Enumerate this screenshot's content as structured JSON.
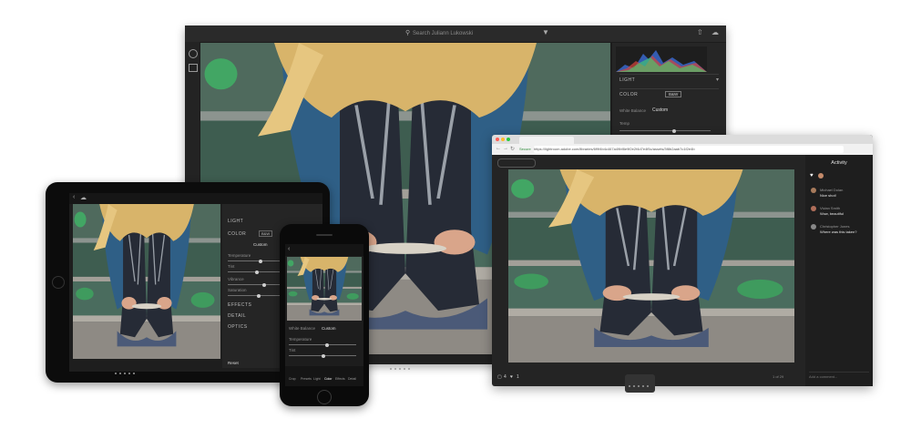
{
  "desktop": {
    "search_placeholder": "Search Juliann Lukowski",
    "panel": {
      "light_label": "LIGHT",
      "color_label": "COLOR",
      "raw_badge": "B&W",
      "white_balance_label": "White Balance",
      "white_balance_value": "Custom",
      "temp_label": "Temp"
    },
    "icons": [
      "search-icon",
      "filter-icon",
      "share-icon",
      "cloud-icon",
      "add-icon",
      "library-icon",
      "edit-sliders-icon",
      "crop-icon",
      "brush-icon",
      "histogram-icon"
    ]
  },
  "browser": {
    "secure_label": "Secure",
    "url": "https://lightroom.adobe.com/libraries/6f9f4b4c467a49bf8e9f2e2f4d7e4f5c/assets/3f8b2aab7c1f2e4b"
  },
  "activity": {
    "title": "Activity",
    "comments": [
      {
        "name": "Michael Dolan",
        "text": "Nice shot!"
      },
      {
        "name": "Vivian Smith",
        "text": "Wow, beautiful"
      },
      {
        "name": "Christopher Jones",
        "text": "Where was this taken?"
      }
    ],
    "input_placeholder": "Add a comment..."
  },
  "browser_bottom": {
    "likes_count": "4",
    "comments_count": "1",
    "pager": "1 of 29"
  },
  "tablet": {
    "panel": {
      "light_label": "LIGHT",
      "color_label": "COLOR",
      "raw_badge": "B&W",
      "white_balance_value": "Custom",
      "temp_label": "Temperature",
      "tint_label": "Tint",
      "vibrance_label": "Vibrance",
      "saturation_label": "Saturation",
      "effects_label": "EFFECTS",
      "detail_label": "DETAIL",
      "optics_label": "OPTICS",
      "reset_label": "Reset"
    }
  },
  "phone": {
    "white_balance_label": "White Balance",
    "white_balance_value": "Custom",
    "temp_label": "Temperature",
    "tint_label": "Tint",
    "tabs": [
      "Crop",
      "Presets",
      "Light",
      "Color",
      "Effects",
      "Detail"
    ]
  },
  "colors": {
    "ui_dark": "#1c1c1c",
    "panel": "#262626",
    "denim": "#2f5f86",
    "hair": "#d8b46a",
    "moss": "#3d8f5a",
    "boots": "#2a2f3a"
  }
}
